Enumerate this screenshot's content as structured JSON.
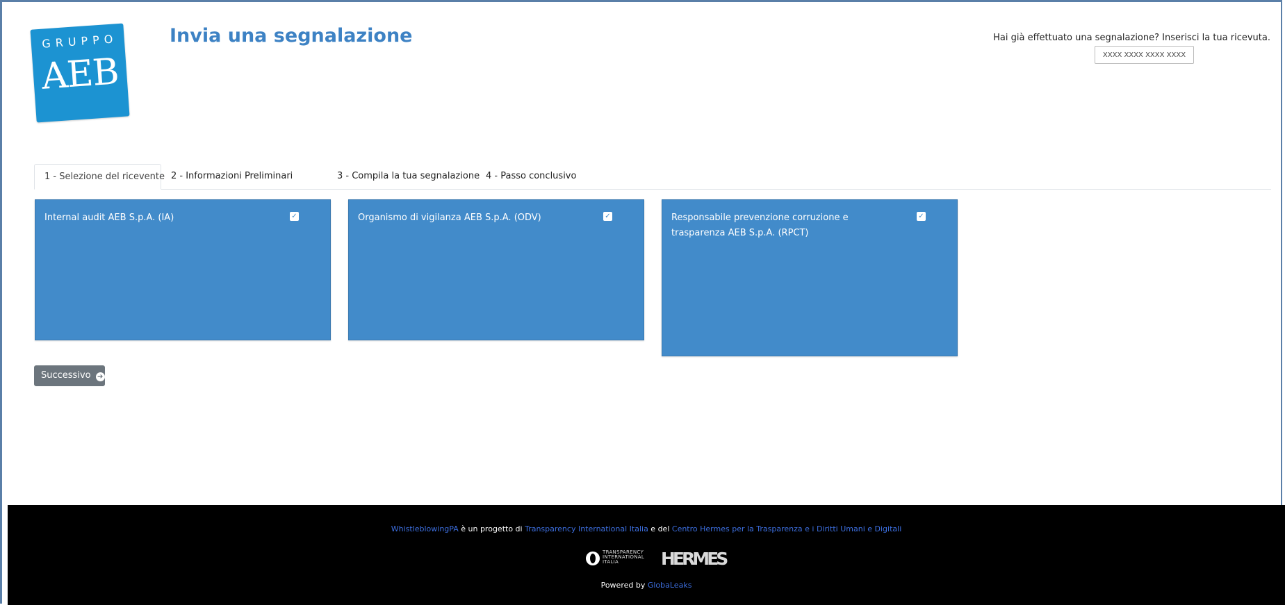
{
  "logo": {
    "top_text": "GRUPPO",
    "main_text": "AEB"
  },
  "header": {
    "title": "Invia una segnalazione",
    "receipt_prompt": "Hai già effettuato una segnalazione? Inserisci la tua ricevuta.",
    "receipt_placeholder": "XXXX XXXX XXXX XXXX"
  },
  "tabs": [
    {
      "label": "1 - Selezione del ricevente",
      "active": true
    },
    {
      "label": "2 - Informazioni Preliminari",
      "active": false
    },
    {
      "label": "3 - Compila la tua segnalazione",
      "active": false
    },
    {
      "label": "4 - Passo conclusivo",
      "active": false
    }
  ],
  "recipients": [
    {
      "label": "Internal audit AEB S.p.A. (IA)",
      "checked": true
    },
    {
      "label": "Organismo di vigilanza AEB S.p.A. (ODV)",
      "checked": true
    },
    {
      "label": "Responsabile prevenzione corruzione e trasparenza AEB S.p.A. (RPCT)",
      "checked": true
    }
  ],
  "actions": {
    "next_label": "Successivo",
    "next_icon": "arrow-circle-right-icon"
  },
  "footer": {
    "project_link": "WhistleblowingPA",
    "text_1": " è un progetto di ",
    "ti_link": "Transparency International Italia",
    "text_2": " e del ",
    "hermes_link": "Centro Hermes per la Trasparenza e i Diritti Umani e Digitali",
    "ti_logo_text": [
      "TRANSPARENCY",
      "INTERNATIONAL",
      "ITALIA"
    ],
    "hermes_logo_text": "HERMES",
    "powered_by": "Powered by ",
    "globaleaks_link": "GlobaLeaks"
  },
  "colors": {
    "accent": "#428bca",
    "title": "#3d82c4",
    "logo": "#1c93d2",
    "footer_bg": "#000000",
    "link": "#3d6fe0"
  }
}
